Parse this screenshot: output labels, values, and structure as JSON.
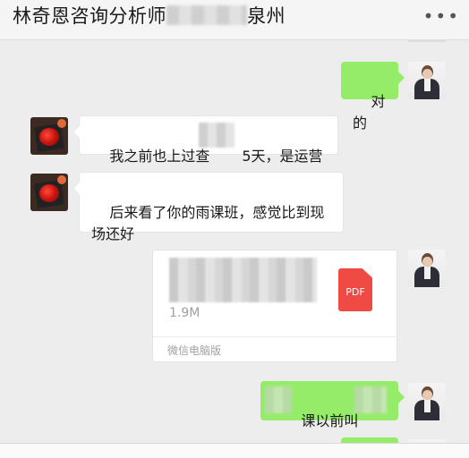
{
  "header": {
    "title_prefix": "林奇恩咨询分析师",
    "title_suffix": "泉州",
    "more_icon": "more-dots-icon"
  },
  "messages": [
    {
      "from": "me",
      "text": "对的"
    },
    {
      "from": "other",
      "text": "我之前也上过查",
      "text_after": "5天，是运营"
    },
    {
      "from": "other",
      "text": "后来看了你的雨课班，感觉比到现场还好"
    },
    {
      "from": "me",
      "type": "file",
      "file_size": "1.9M",
      "file_type": "PDF",
      "source": "微信电脑版"
    },
    {
      "from": "me",
      "text": "课以前叫",
      "partial": true
    },
    {
      "from": "me",
      "text": "",
      "partial": true
    }
  ],
  "colors": {
    "me_bubble": "#95ec69",
    "other_bubble": "#ffffff",
    "background": "#ededed",
    "pdf": "#f04a45"
  }
}
